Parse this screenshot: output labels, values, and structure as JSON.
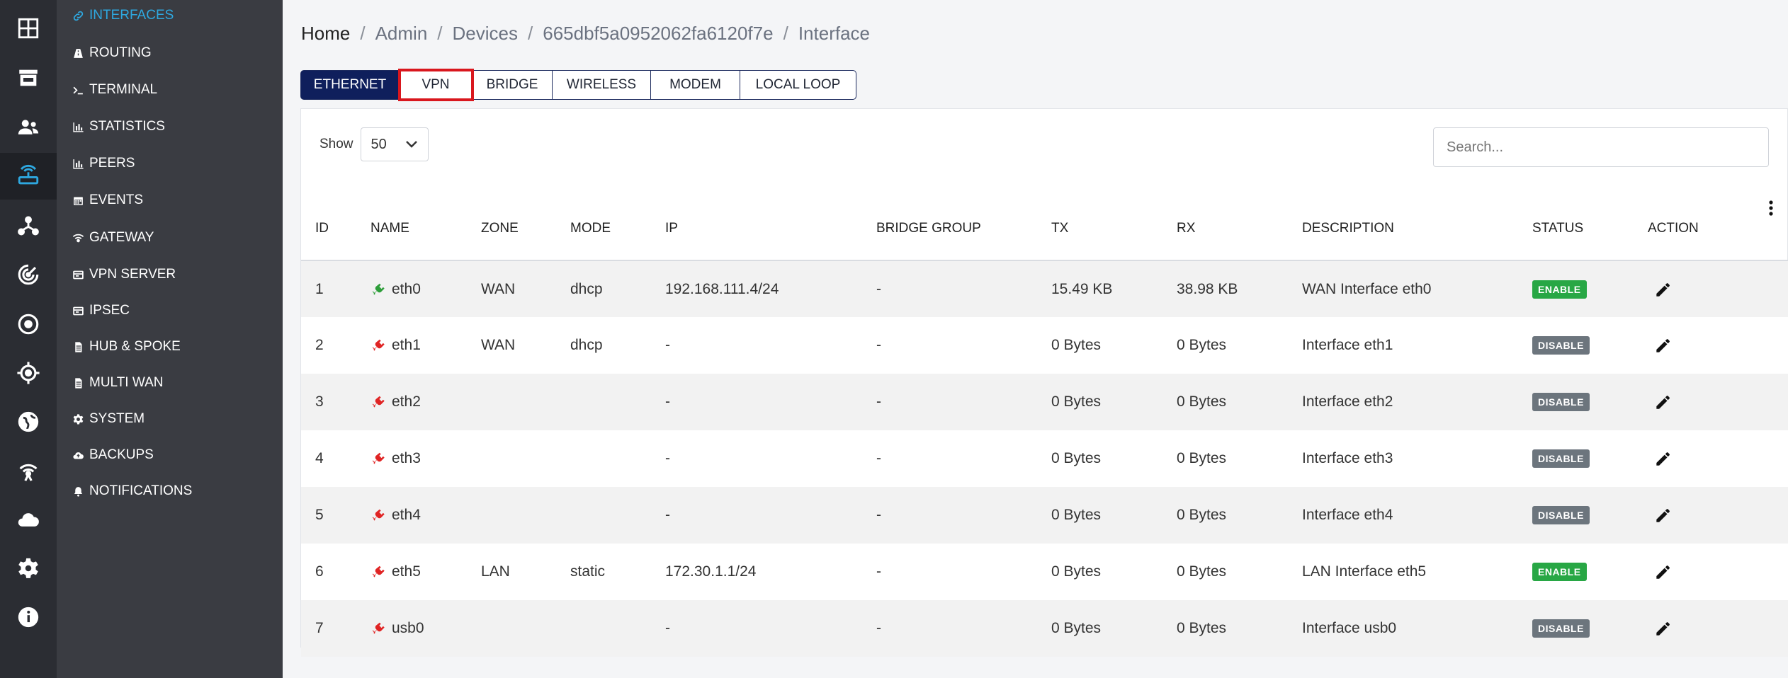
{
  "rail": {
    "items": [
      {
        "icon": "dashboard-grid-icon"
      },
      {
        "icon": "store-icon"
      },
      {
        "icon": "users-icon"
      },
      {
        "icon": "router-icon",
        "active": true
      },
      {
        "icon": "network-topology-icon"
      },
      {
        "icon": "radar-icon"
      },
      {
        "icon": "target-circle-icon"
      },
      {
        "icon": "crosshair-icon"
      },
      {
        "icon": "globe-icon"
      },
      {
        "icon": "antenna-broadcast-icon"
      },
      {
        "icon": "cloud-icon"
      },
      {
        "icon": "settings-gear-icon"
      },
      {
        "icon": "info-icon"
      }
    ]
  },
  "subnav": {
    "items": [
      {
        "label": "INTERFACES",
        "icon": "link-icon",
        "active": true
      },
      {
        "label": "ROUTING",
        "icon": "road-icon"
      },
      {
        "label": "TERMINAL",
        "icon": "terminal-icon"
      },
      {
        "label": "STATISTICS",
        "icon": "bar-chart-icon"
      },
      {
        "label": "PEERS",
        "icon": "bar-chart-icon"
      },
      {
        "label": "EVENTS",
        "icon": "calendar-icon"
      },
      {
        "label": "GATEWAY",
        "icon": "wifi-icon"
      },
      {
        "label": "VPN SERVER",
        "icon": "server-icon"
      },
      {
        "label": "IPSEC",
        "icon": "server-icon"
      },
      {
        "label": "HUB & SPOKE",
        "icon": "file-icon"
      },
      {
        "label": "MULTI WAN",
        "icon": "file-icon"
      },
      {
        "label": "SYSTEM",
        "icon": "gear-icon"
      },
      {
        "label": "BACKUPS",
        "icon": "cloud-upload-icon"
      },
      {
        "label": "NOTIFICATIONS",
        "icon": "bell-icon"
      }
    ]
  },
  "breadcrumb": {
    "home": "Home",
    "sep": "/",
    "items": [
      "Admin",
      "Devices",
      "665dbf5a0952062fa6120f7e",
      "Interface"
    ]
  },
  "tabs": [
    {
      "label": "ETHERNET",
      "active": true
    },
    {
      "label": "VPN",
      "highlighted": true
    },
    {
      "label": "BRIDGE"
    },
    {
      "label": "WIRELESS"
    },
    {
      "label": "MODEM"
    },
    {
      "label": "LOCAL LOOP"
    }
  ],
  "table_controls": {
    "show_label": "Show",
    "page_size": "50",
    "search_placeholder": "Search..."
  },
  "table": {
    "columns": [
      "ID",
      "NAME",
      "ZONE",
      "MODE",
      "IP",
      "BRIDGE GROUP",
      "TX",
      "RX",
      "DESCRIPTION",
      "STATUS",
      "ACTION"
    ],
    "rows": [
      {
        "id": "1",
        "name": "eth0",
        "connected": true,
        "zone": "WAN",
        "mode": "dhcp",
        "ip": "192.168.111.4/24",
        "bridge": "-",
        "tx": "15.49 KB",
        "rx": "38.98 KB",
        "desc": "WAN Interface eth0",
        "status": "ENABLE"
      },
      {
        "id": "2",
        "name": "eth1",
        "connected": false,
        "zone": "WAN",
        "mode": "dhcp",
        "ip": "-",
        "bridge": "-",
        "tx": "0 Bytes",
        "rx": "0 Bytes",
        "desc": "Interface eth1",
        "status": "DISABLE"
      },
      {
        "id": "3",
        "name": "eth2",
        "connected": false,
        "zone": "",
        "mode": "",
        "ip": "-",
        "bridge": "-",
        "tx": "0 Bytes",
        "rx": "0 Bytes",
        "desc": "Interface eth2",
        "status": "DISABLE"
      },
      {
        "id": "4",
        "name": "eth3",
        "connected": false,
        "zone": "",
        "mode": "",
        "ip": "-",
        "bridge": "-",
        "tx": "0 Bytes",
        "rx": "0 Bytes",
        "desc": "Interface eth3",
        "status": "DISABLE"
      },
      {
        "id": "5",
        "name": "eth4",
        "connected": false,
        "zone": "",
        "mode": "",
        "ip": "-",
        "bridge": "-",
        "tx": "0 Bytes",
        "rx": "0 Bytes",
        "desc": "Interface eth4",
        "status": "DISABLE"
      },
      {
        "id": "6",
        "name": "eth5",
        "connected": false,
        "zone": "LAN",
        "mode": "static",
        "ip": "172.30.1.1/24",
        "bridge": "-",
        "tx": "0 Bytes",
        "rx": "0 Bytes",
        "desc": "LAN Interface eth5",
        "status": "ENABLE"
      },
      {
        "id": "7",
        "name": "usb0",
        "connected": false,
        "zone": "",
        "mode": "",
        "ip": "-",
        "bridge": "-",
        "tx": "0 Bytes",
        "rx": "0 Bytes",
        "desc": "Interface usb0",
        "status": "DISABLE"
      }
    ]
  },
  "colors": {
    "accent": "#2ea8e0",
    "tab_active": "#0f1f5c",
    "highlight": "#d9171e",
    "enable": "#28a745",
    "disable": "#6c757d",
    "plug_connected": "#2e9e3a",
    "plug_disconnected": "#e02424"
  }
}
